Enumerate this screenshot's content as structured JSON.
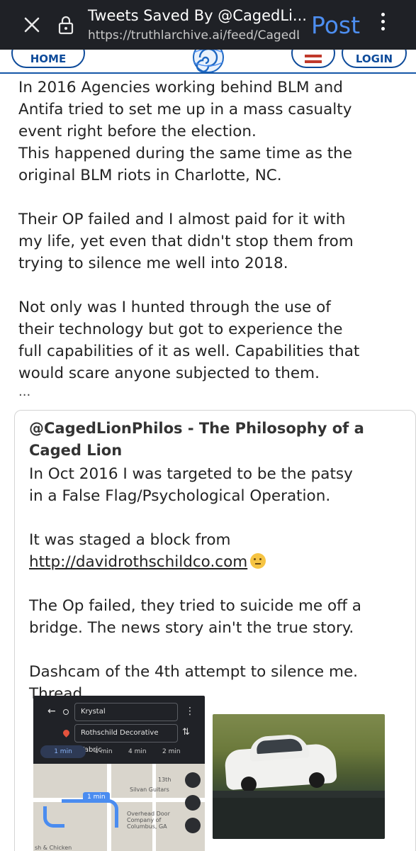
{
  "browser": {
    "title": "Tweets Saved By @CagedLi...",
    "url": "https://truthlarchive.ai/feed/CagedL",
    "action": "Post",
    "close_icon": "close-icon",
    "lock_icon": "lock-icon",
    "menu_icon": "more-vert-icon"
  },
  "nav": {
    "home": "HOME",
    "login": "LOGIN",
    "flag_icon": "us-flag-icon",
    "logo_icon": "spiral-logo-icon"
  },
  "post": {
    "text": "In 2016 Agencies working behind BLM and\nAntifa tried to set me up in a mass casualty\nevent right before the election.\nThis happened during the same time as the\noriginal BLM riots in Charlotte, NC.\n\nTheir OP failed and I almost paid for it with\nmy life, yet even that didn't stop them from\ntrying to silence me well into 2018.\n\nNot only was I hunted through the use of\ntheir technology but got to experience the\nfull capabilities of it as well. Capabilities that\nwould scare anyone subjected to them.",
    "more": "..."
  },
  "quote": {
    "title": "@CagedLionPhilos - The Philosophy of a Caged Lion",
    "body_1": "In Oct 2016 I was targeted to be the patsy\nin a False Flag/Psychological Operation.\n\nIt was staged a block from",
    "link": "http://davidrothschildco.com",
    "emoji": "thinking-face-emoji",
    "body_2": "The Op failed, they tried to suicide me off a\nbridge. The news story ain't the true story.\n\nDashcam of the 4th attempt to silence me.\nThread"
  },
  "map": {
    "from": "Krystal",
    "to": "Rothschild Decorative Fabric",
    "modes": [
      "1 min",
      "4 min",
      "4 min",
      "2 min"
    ],
    "route_bubble": "1 min",
    "labels": [
      "13th",
      "Silvan Guitars",
      "Overhead Door Company of Columbus, GA",
      "sh & Chicken"
    ]
  },
  "colors": {
    "topbar_bg": "#1f2126",
    "post_action": "#4d8ef0",
    "nav_accent": "#0e4b9a",
    "route": "#4a8cf0"
  }
}
